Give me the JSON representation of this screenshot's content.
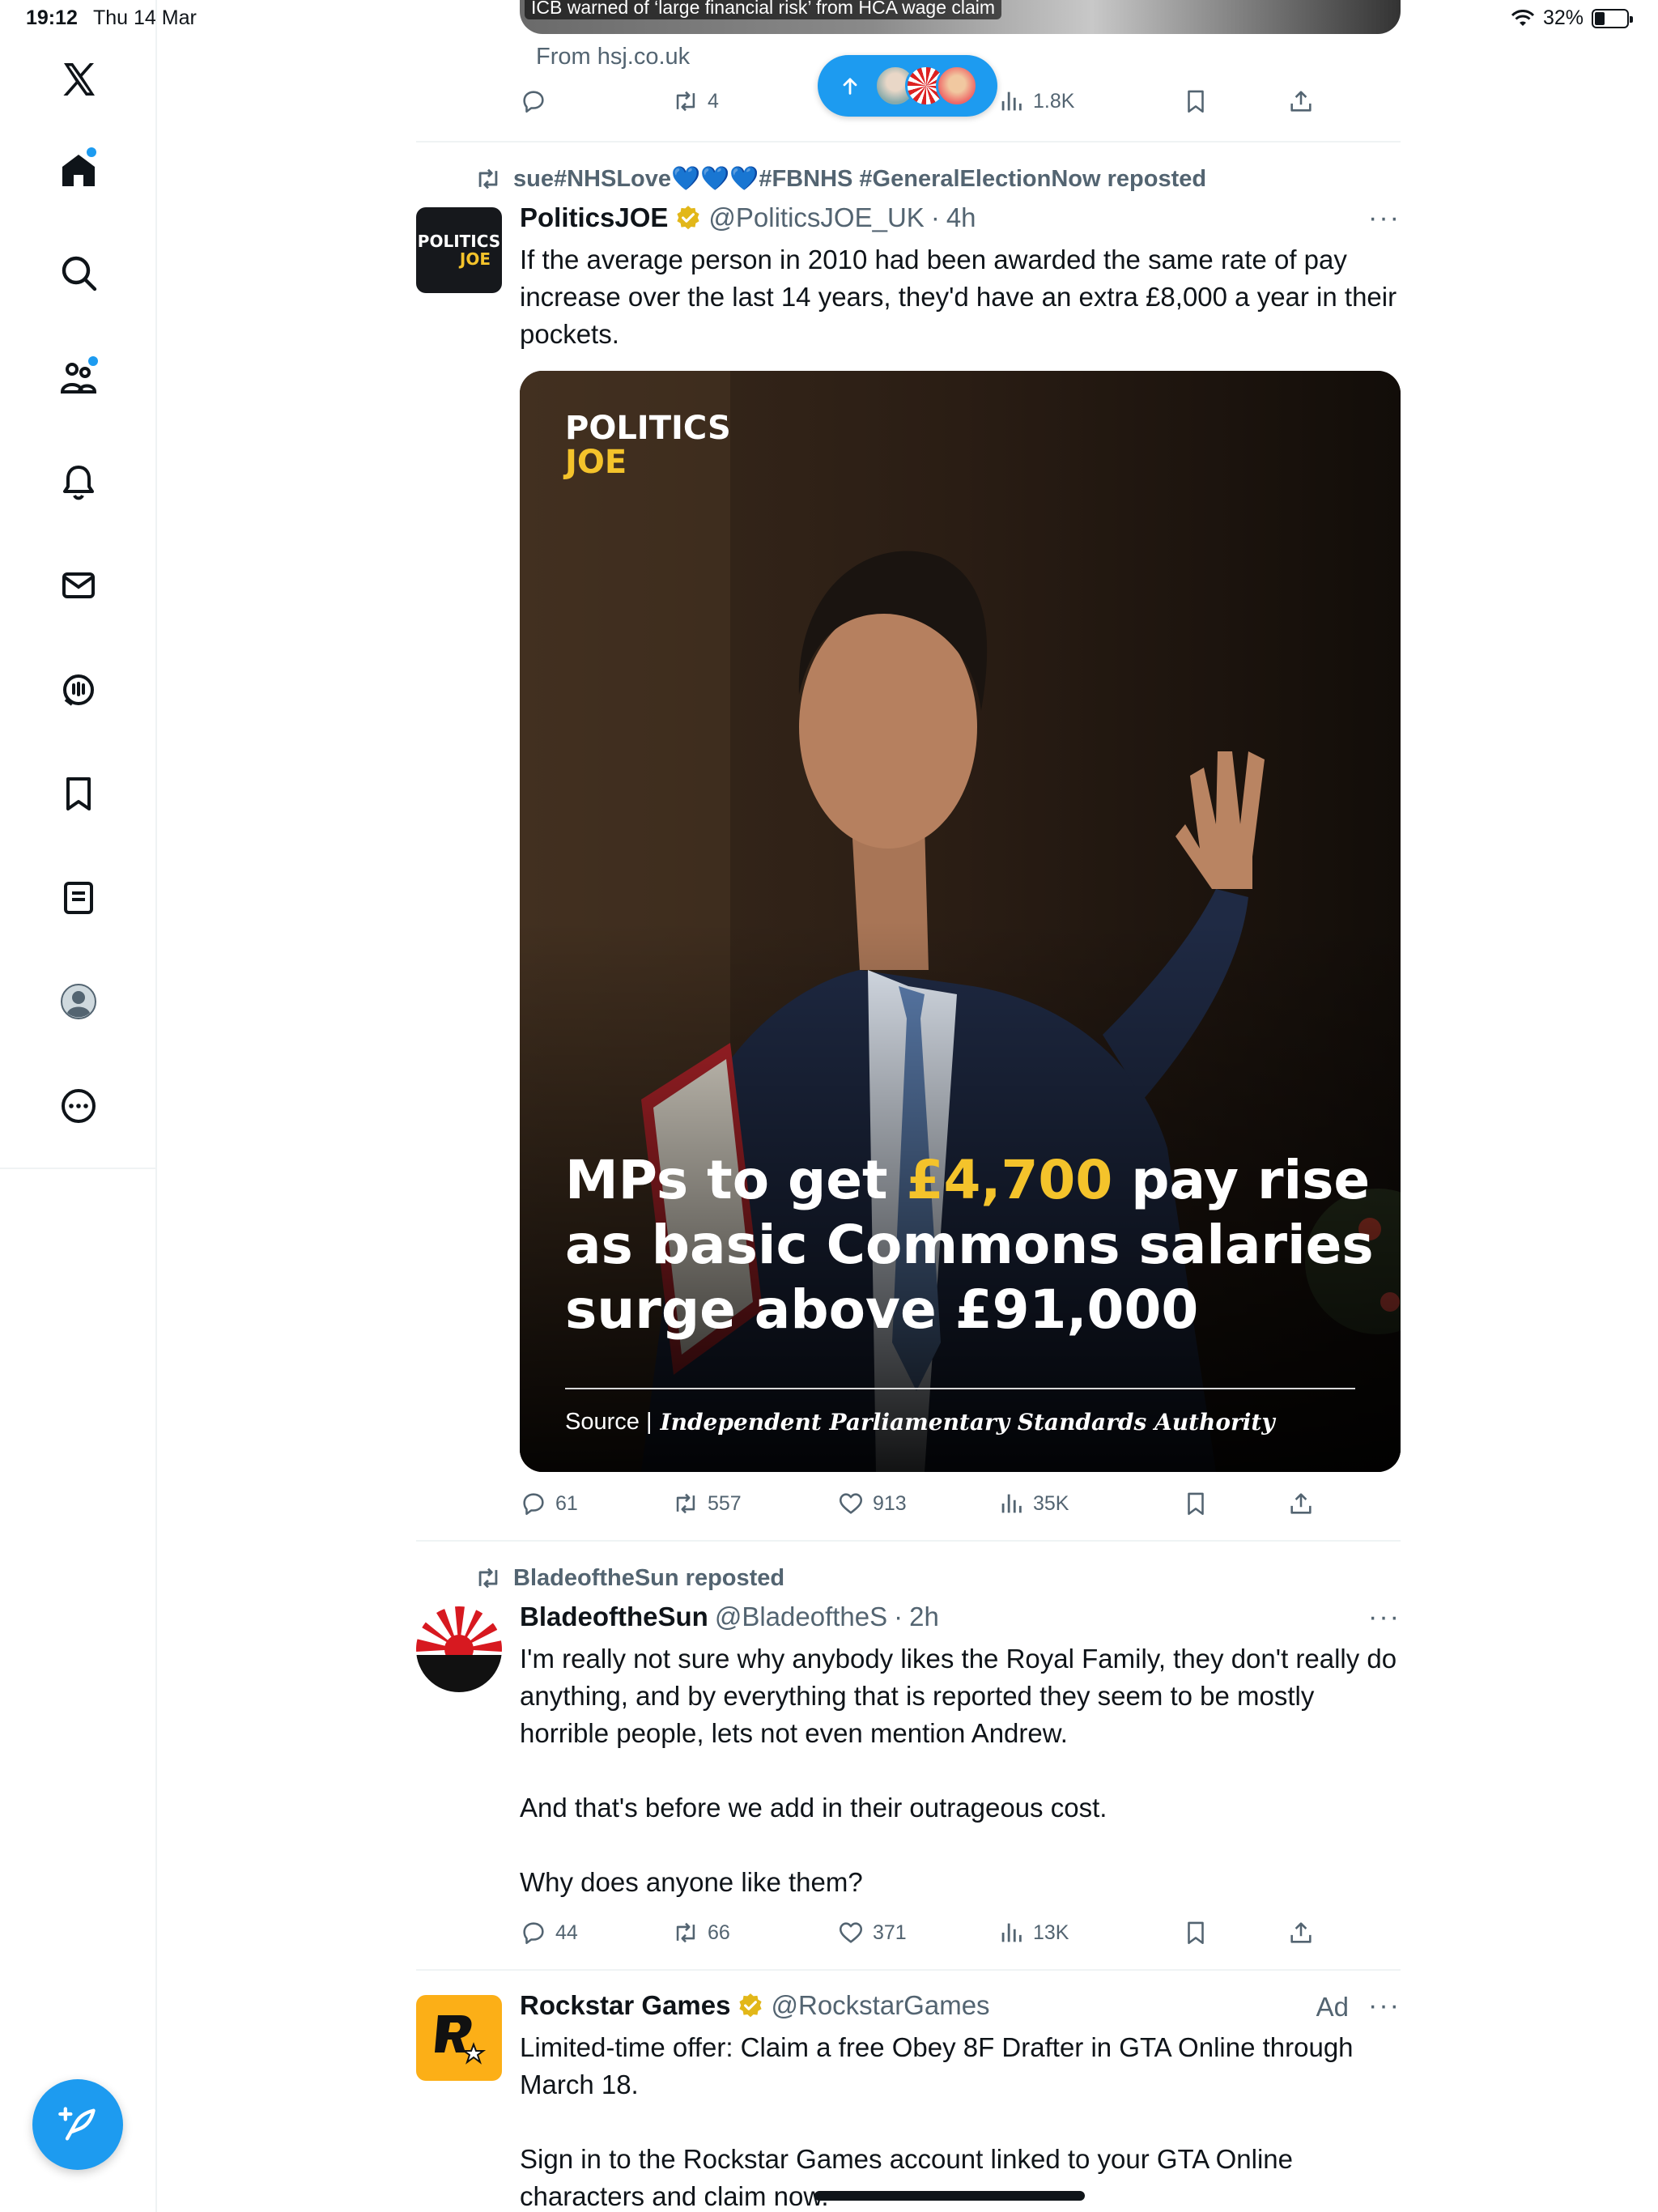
{
  "status_bar": {
    "time": "19:12",
    "date": "Thu 14 Mar",
    "battery": "32%",
    "battery_level": 0.32
  },
  "sidebar": {
    "items": [
      {
        "name": "home",
        "label": "Home"
      },
      {
        "name": "explore",
        "label": "Search"
      },
      {
        "name": "communities",
        "label": "Communities"
      },
      {
        "name": "notifications",
        "label": "Notifications"
      },
      {
        "name": "messages",
        "label": "Messages"
      },
      {
        "name": "grok",
        "label": "Grok"
      },
      {
        "name": "bookmarks",
        "label": "Bookmarks"
      },
      {
        "name": "lists",
        "label": "Lists"
      },
      {
        "name": "profile",
        "label": "Profile"
      },
      {
        "name": "more",
        "label": "More"
      }
    ]
  },
  "feed": {
    "top_card": {
      "caption": "ICB warned of ‘large financial risk’ from HCA wage claim",
      "source": "From hsj.co.uk",
      "reposts": "4",
      "views": "1.8K"
    },
    "tweets": [
      {
        "reposted_by": "sue#NHSLove💙💙💙#FBNHS #GeneralElectionNow reposted",
        "name": "PoliticsJOE",
        "handle": "@PoliticsJOE_UK",
        "time": "4h",
        "text": "If the average person in 2010 had been awarded the same rate of pay increase over the last 14 years, they'd have an extra £8,000 a year in their pockets.",
        "media": {
          "logo_top": "POLITICS",
          "logo_bottom": "JOE",
          "headline_pre": "MPs to get ",
          "headline_highlight": "£4,700",
          "headline_line1_post": " pay rise",
          "headline_line2": "as basic Commons salaries",
          "headline_line3": "surge above £91,000",
          "source_label": "Source |",
          "source_name": "Independent Parliamentary Standards Authority"
        },
        "stats": {
          "replies": "61",
          "reposts": "557",
          "likes": "913",
          "views": "35K"
        }
      },
      {
        "reposted_by": "BladeoftheSun reposted",
        "name": "BladeoftheSun",
        "handle": "@BladeoftheS",
        "time": "2h",
        "text": "I'm really not sure why anybody likes the Royal Family, they don't really do anything, and by everything that is reported they seem to be mostly horrible people, lets not even mention Andrew.\n\nAnd that's before we add in their outrageous cost.\n\nWhy does anyone like them?",
        "stats": {
          "replies": "44",
          "reposts": "66",
          "likes": "371",
          "views": "13K"
        }
      },
      {
        "name": "Rockstar Games",
        "handle": "@RockstarGames",
        "ad_label": "Ad",
        "text": "Limited-time offer: Claim a free Obey 8F Drafter in GTA Online through March 18.\n\nSign in to the Rockstar Games account linked to your GTA Online characters and claim now."
      }
    ]
  },
  "colors": {
    "accent": "#1d9bf0",
    "text": "#0f1419",
    "muted": "#536471",
    "border": "#eff3f4",
    "gold": "#f4c32b"
  }
}
